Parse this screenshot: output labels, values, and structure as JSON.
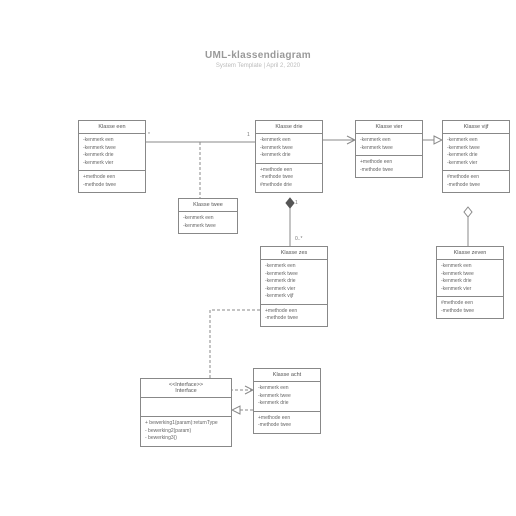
{
  "header": {
    "title": "UML-klassendiagram",
    "subtitle": "System Template  |  April 2, 2020"
  },
  "classes": {
    "een": {
      "name": "Klasse een",
      "attrs": [
        "-kenmerk een",
        "-kenmerk twee",
        "-kenmerk drie",
        "-kenmerk vier"
      ],
      "methods": [
        "+methode een",
        "-methode twee"
      ]
    },
    "twee": {
      "name": "Klasse twee",
      "attrs": [
        "-kenmerk een",
        "-kenmerk twee"
      ],
      "methods": null
    },
    "drie": {
      "name": "Klasse drie",
      "attrs": [
        "-kenmerk een",
        "-kenmerk twee",
        "-kenmerk drie"
      ],
      "methods": [
        "+methode een",
        "-methode twee",
        "#methode drie"
      ]
    },
    "vier": {
      "name": "Klasse vier",
      "attrs": [
        "-kenmerk een",
        "-kenmerk twee"
      ],
      "methods": [
        "+methode een",
        "-methode twee"
      ]
    },
    "vijf": {
      "name": "Klasse vijf",
      "attrs": [
        "-kenmerk een",
        "-kenmerk twee",
        "-kenmerk drie",
        "-kenmerk vier"
      ],
      "methods": [
        "#methode een",
        "-methode twee"
      ]
    },
    "zes": {
      "name": "Klasse zes",
      "attrs": [
        "-kenmerk een",
        "-kenmerk twee",
        "-kenmerk drie",
        "-kenmerk vier",
        "-kenmerk vijf"
      ],
      "methods": [
        "+methode een",
        "-methode twee"
      ]
    },
    "zeven": {
      "name": "Klasse zeven",
      "attrs": [
        "-kenmerk een",
        "-kenmerk twee",
        "-kenmerk drie",
        "-kenmerk vier"
      ],
      "methods": [
        "#methode een",
        "-methode twee"
      ]
    },
    "acht": {
      "name": "Klasse acht",
      "attrs": [
        "-kenmerk een",
        "-kenmerk twee",
        "-kenmerk drie"
      ],
      "methods": [
        "+methode een",
        "-methode twee"
      ]
    },
    "interface": {
      "stereo": "<<Interface>>",
      "name": "Interface",
      "ops": [
        "+ bewerking1(param):returnType",
        "- bewerking2(param)",
        "- bewerking3()"
      ]
    }
  },
  "mult": {
    "een_r": "*",
    "drie_l": "1",
    "drie_b": "1",
    "zes_t": "0..*"
  }
}
